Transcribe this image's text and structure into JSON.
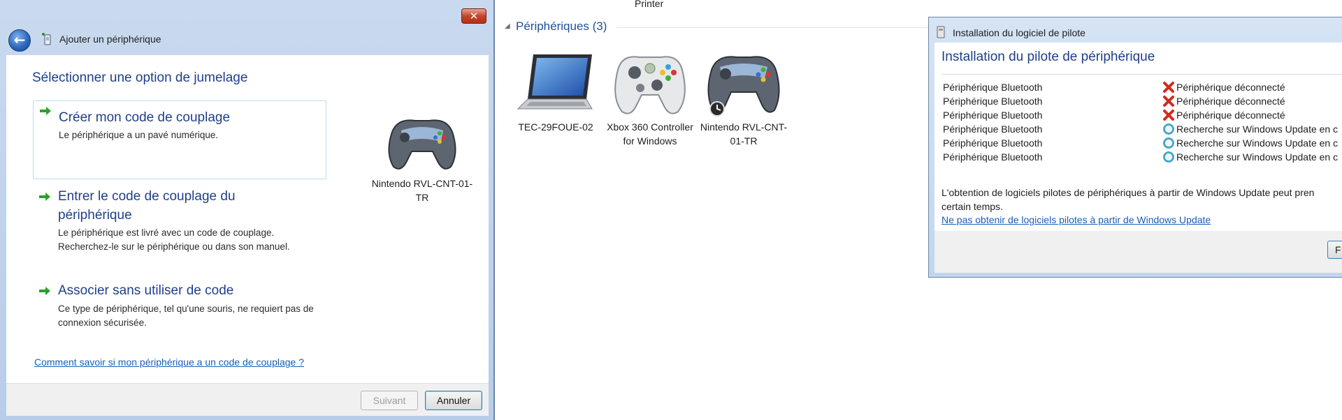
{
  "wizard": {
    "title": "Ajouter un périphérique",
    "close_label": "✕",
    "back_label": "←",
    "heading": "Sélectionner une option de jumelage",
    "options": [
      {
        "title": "Créer mon code de couplage",
        "desc": "Le périphérique a un pavé numérique."
      },
      {
        "title": "Entrer le code de couplage du périphérique",
        "desc": "Le périphérique est livré avec un code de couplage. Recherchez-le sur le périphérique ou dans son manuel."
      },
      {
        "title": "Associer sans utiliser de code",
        "desc": "Ce type de périphérique, tel qu'une souris, ne requiert pas de connexion sécurisée."
      }
    ],
    "help_link": "Comment savoir si mon périphérique a un code de couplage ?",
    "device_label": "Nintendo RVL-CNT-01-TR",
    "next_label": "Suivant",
    "cancel_label": "Annuler"
  },
  "devices_pane": {
    "printer_label": "Printer",
    "group_toggle": "◢",
    "group_header": "Périphériques (3)",
    "devices": [
      {
        "label": "TEC-29FOUE-02",
        "icon": "laptop-icon"
      },
      {
        "label": "Xbox 360 Controller for Windows",
        "icon": "xbox-controller-icon"
      },
      {
        "label": "Nintendo RVL-CNT-01-TR",
        "icon": "gamepad-icon"
      }
    ]
  },
  "driver_dialog": {
    "title": "Installation du logiciel de pilote",
    "heading": "Installation du pilote de périphérique",
    "rows": [
      {
        "name": "Périphérique Bluetooth",
        "status": "Périphérique déconnecté",
        "state": "error"
      },
      {
        "name": "Périphérique Bluetooth",
        "status": "Périphérique déconnecté",
        "state": "error"
      },
      {
        "name": "Périphérique Bluetooth",
        "status": "Périphérique déconnecté",
        "state": "error"
      },
      {
        "name": "Périphérique Bluetooth",
        "status": "Recherche sur Windows Update en c",
        "state": "searching"
      },
      {
        "name": "Périphérique Bluetooth",
        "status": "Recherche sur Windows Update en c",
        "state": "searching"
      },
      {
        "name": "Périphérique Bluetooth",
        "status": "Recherche sur Windows Update en c",
        "state": "searching"
      }
    ],
    "info_line1": "L'obtention de logiciels pilotes de périphériques à partir de Windows Update peut pren",
    "info_line2": "certain temps.",
    "link": "Ne pas obtenir de logiciels pilotes à partir de Windows Update",
    "close_btn_label": "F"
  },
  "colors": {
    "accent_blue": "#1f3f8a",
    "link_blue": "#1a5fb4",
    "error_red": "#d42a1c",
    "arrow_green": "#2e9e2e"
  }
}
